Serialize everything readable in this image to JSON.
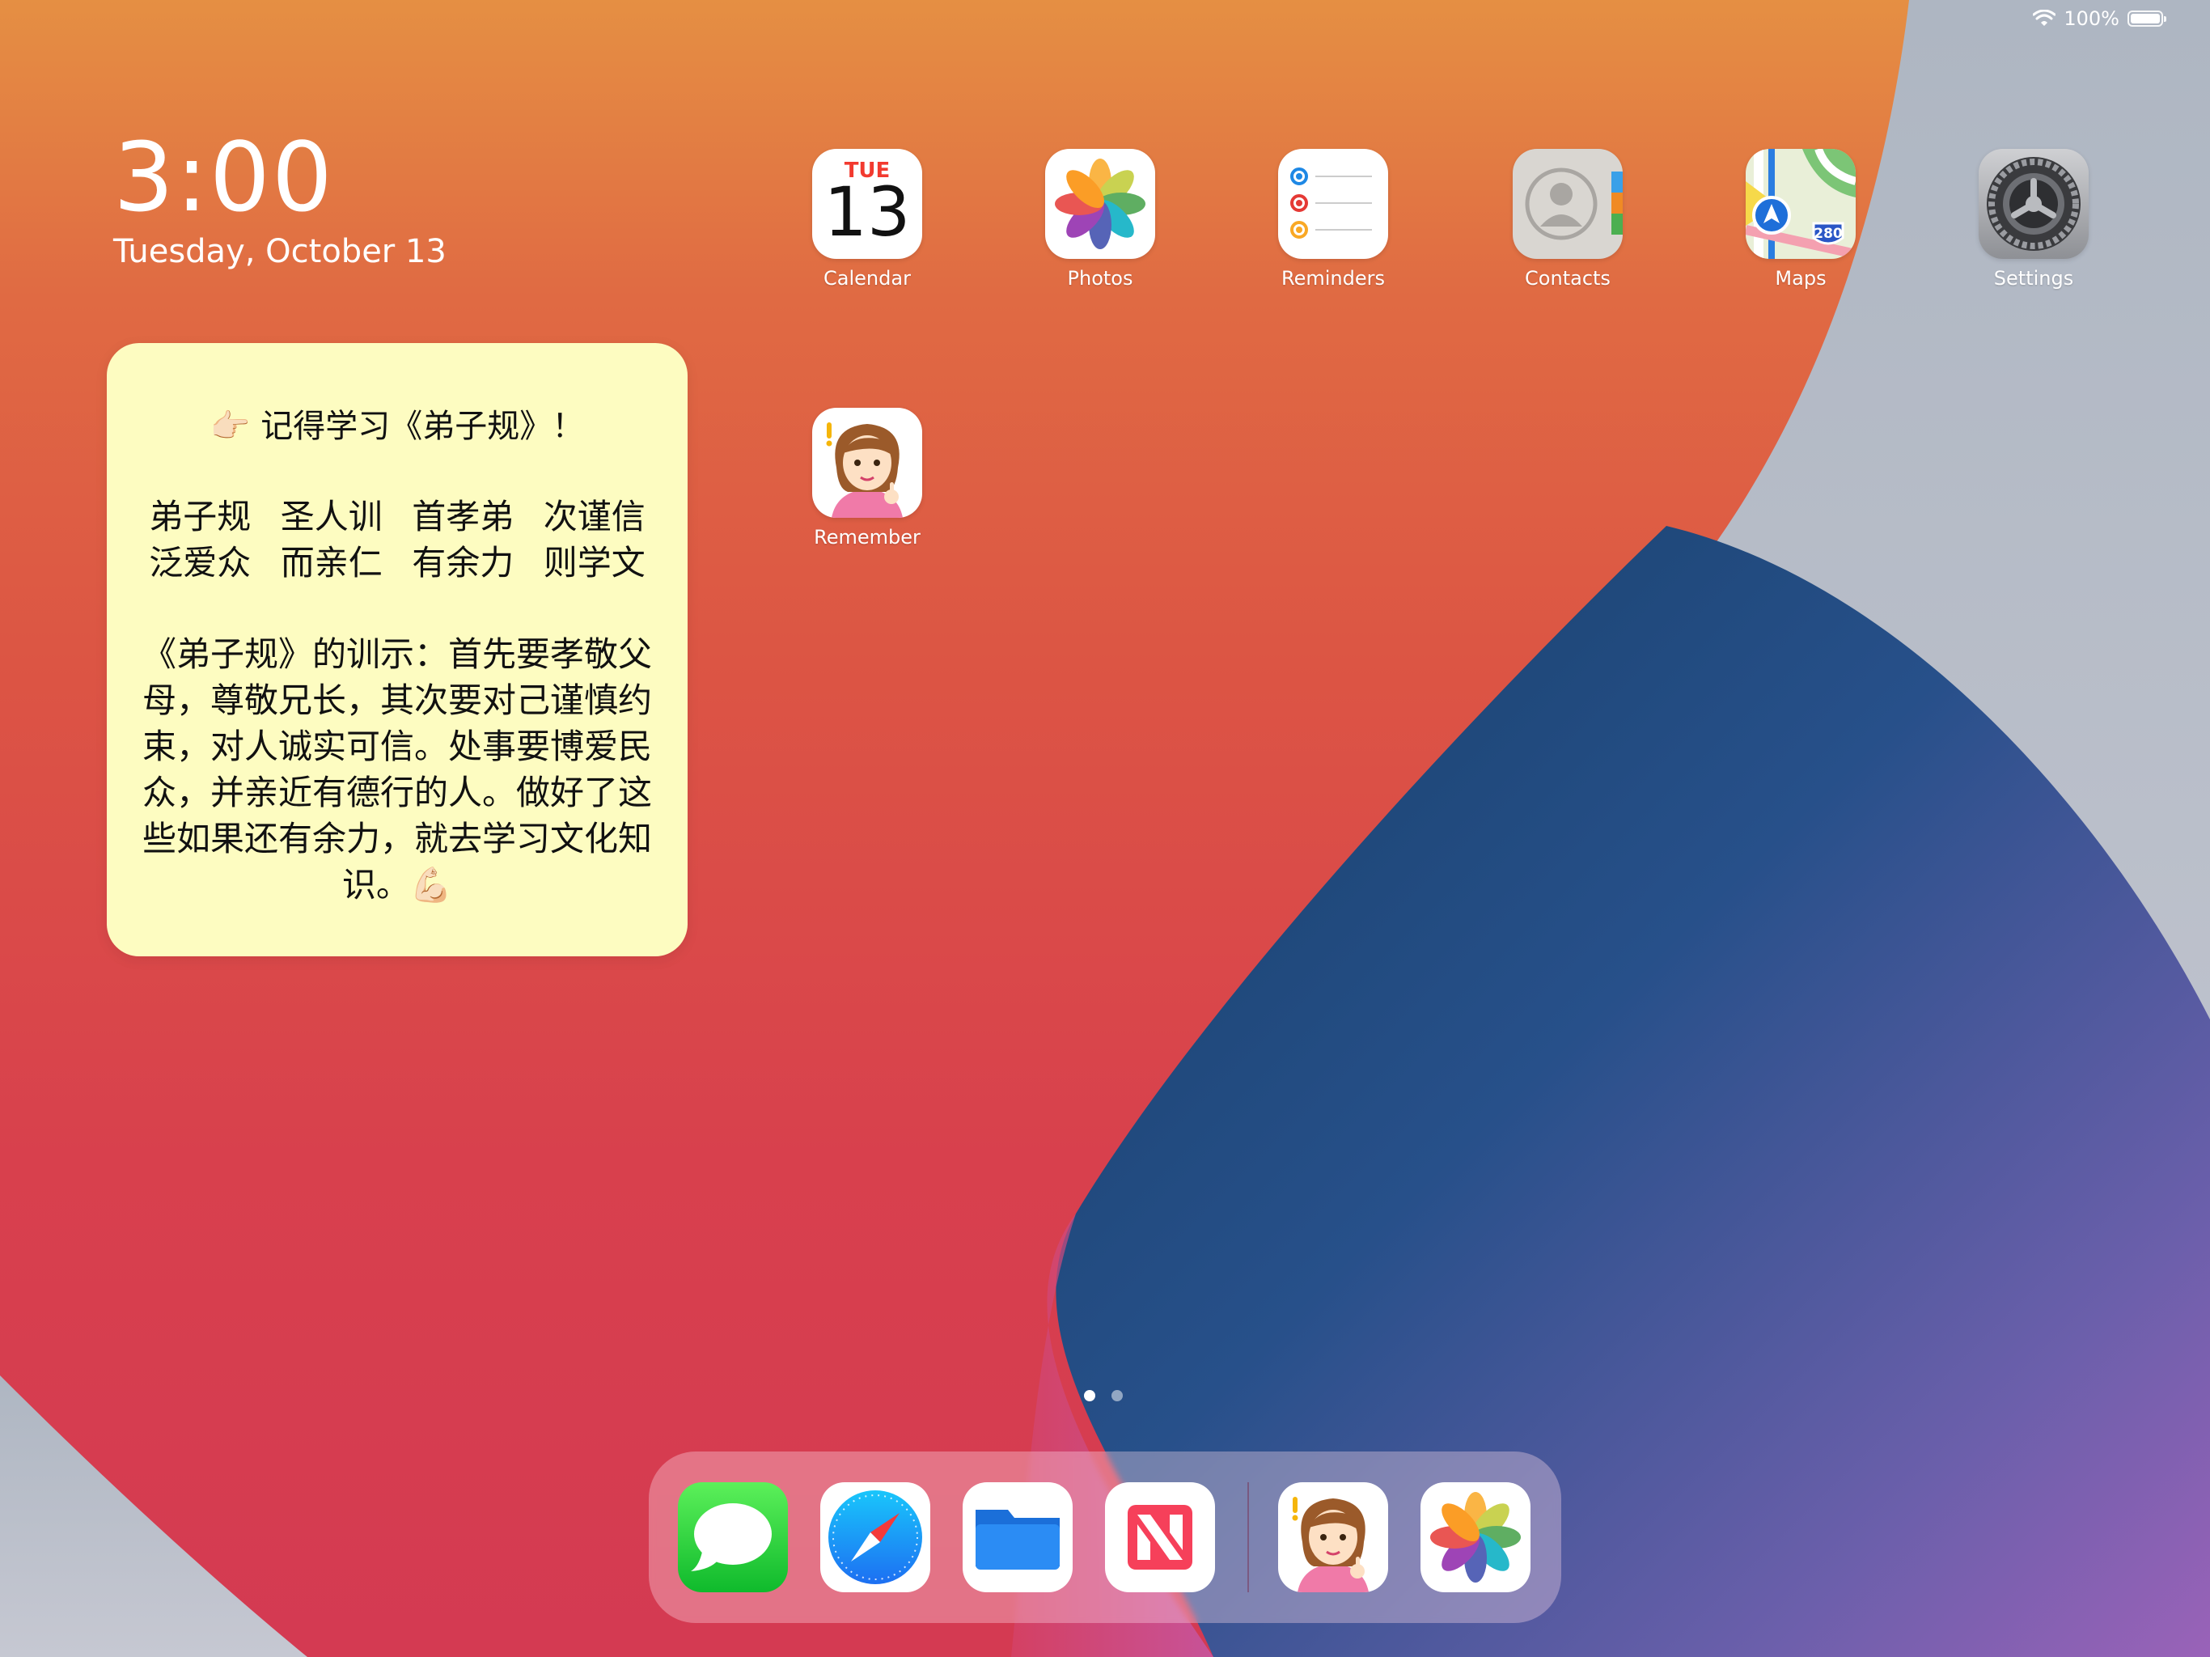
{
  "status": {
    "battery": "100%"
  },
  "clock": {
    "time": "3:00",
    "date": "Tuesday, October 13"
  },
  "widget": {
    "title": "👉🏻 记得学习《弟子规》！",
    "verse": [
      "弟子规",
      "圣人训",
      "首孝弟",
      "次谨信",
      "泛爱众",
      "而亲仁",
      "有余力",
      "则学文"
    ],
    "explain": "《弟子规》的训示：首先要孝敬父母，尊敬兄长，其次要对己谨慎约束，对人诚实可信。处事要博爱民众，并亲近有德行的人。做好了这些如果还有余力，就去学习文化知识。💪🏻"
  },
  "apps": {
    "calendar": {
      "label": "Calendar",
      "day": "TUE",
      "num": "13"
    },
    "photos": {
      "label": "Photos"
    },
    "reminders": {
      "label": "Reminders"
    },
    "contacts": {
      "label": "Contacts"
    },
    "maps": {
      "label": "Maps",
      "shield": "280"
    },
    "settings": {
      "label": "Settings"
    },
    "remember": {
      "label": "Remember"
    }
  },
  "colors": {
    "accent_red": "#f23a2f",
    "widget_bg": "#fdfcc1",
    "wall_blue": "#1d4a7a"
  }
}
